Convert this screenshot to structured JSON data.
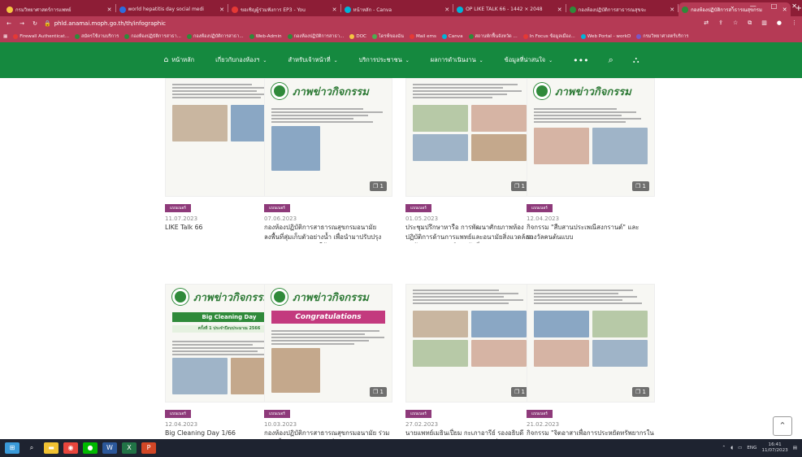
{
  "browser": {
    "tabs": [
      {
        "title": "กรมวิทยาศาสตร์การแพทย์",
        "color": "#f5c542",
        "active": false
      },
      {
        "title": "world hepatitis day social medi",
        "color": "#2d6cdf",
        "active": false
      },
      {
        "title": "ขอเชิญผู้ร่วมฟังการ EP3 - You",
        "color": "#e53935",
        "active": false
      },
      {
        "title": "หน้าหลัก - Canva",
        "color": "#00b4d8",
        "active": false
      },
      {
        "title": "OP LIKE TALK 66 - 1442 × 2048",
        "color": "#00b4d8",
        "active": false
      },
      {
        "title": "กองห้องปฏิบัติการสาธารณสุขจะ",
        "color": "#2f8a3a",
        "active": false
      },
      {
        "title": "กองห้องปฏิบัติการสาธารณสุขกรม",
        "color": "#2f8a3a",
        "active": true
      }
    ],
    "new_tab": "+",
    "window_controls": [
      "⌄",
      "—",
      "□",
      "✕"
    ],
    "url": "phld.anamai.moph.go.th/th/infographic",
    "bookmarks": [
      {
        "label": "Firewall Authenticat...",
        "color": "#e53935"
      },
      {
        "label": "สมัครใช้งานบริการ",
        "color": "#2f8a3a"
      },
      {
        "label": "กองห้องปฏิบัติการสาธา...",
        "color": "#2f8a3a"
      },
      {
        "label": "กองห้องปฏิบัติการสาธา...",
        "color": "#2f8a3a"
      },
      {
        "label": "Web-Admin",
        "color": "#2f8a3a"
      },
      {
        "label": "กองห้องปฏิบัติการสาธา...",
        "color": "#2f8a3a"
      },
      {
        "label": "DOC",
        "color": "#f5c542"
      },
      {
        "label": "ไดรฟ์ของฉัน",
        "color": "#4caf50"
      },
      {
        "label": "Mail ems",
        "color": "#e53935"
      },
      {
        "label": "Canva",
        "color": "#00b4d8"
      },
      {
        "label": "สถานพักฟื้นจังหวัด ...",
        "color": "#2f8a3a"
      },
      {
        "label": "In Focus ข้อมูลเมือง...",
        "color": "#e53935"
      },
      {
        "label": "Web Portal - workD",
        "color": "#00b4d8"
      },
      {
        "label": "กรมวิทยาศาสตร์บริการ",
        "color": "#7b57c5"
      }
    ]
  },
  "site_nav": {
    "items": [
      {
        "label": "หน้าหลัก",
        "icon": "home-icon"
      },
      {
        "label": "เกี่ยวกับกองห้องฯ",
        "caret": true
      },
      {
        "label": "สำหรับเจ้าหน้าที่",
        "caret": true
      },
      {
        "label": "บริการประชาชน",
        "caret": true
      },
      {
        "label": "ผลการดำเนินงาน",
        "caret": true
      },
      {
        "label": "ข้อมูลที่น่าสนใจ",
        "caret": true
      }
    ],
    "more": "•••",
    "search_icon": "⌕",
    "sitemap_icon": "⛬"
  },
  "cards": [
    {
      "category": "แบนเนอร์",
      "date": "11.07.2023",
      "title": "LIKE Talk 66",
      "header": "",
      "photos": 2,
      "count": "1"
    },
    {
      "category": "แบนเนอร์",
      "date": "07.06.2023",
      "title": "กองห้องปฏิบัติการสาธารณสุขกรมอนามัย ลงพื้นที่สุ่มเก็บตัวอย่างน้ำ เพื่อนำมาปรับปรุงคุณภาพสุขภาพ ของให้ประชาชน",
      "header": "ภาพข่าวกิจกรรม",
      "photos": 1,
      "count": "1"
    },
    {
      "category": "แบนเนอร์",
      "date": "01.05.2023",
      "title": "ประชุมปรึกษาหารือ การพัฒนาศักยภาพห้องปฏิบัติการด้านการแพทย์และอนามัยสิ่งแวดล้อม ณ ห้องประชุมศูนย์อนามัยที่ 10",
      "header": "",
      "photos": 4,
      "count": "1"
    },
    {
      "category": "แบนเนอร์",
      "date": "12.04.2023",
      "title": "กิจกรรม \"สืบสานประเพณีสงกรานต์\" และรางวัลคนต้นแบบ",
      "header": "ภาพข่าวกิจกรรม",
      "photos": 2,
      "count": "1"
    },
    {
      "category": "แบนเนอร์",
      "date": "12.04.2023",
      "title": "Big Cleaning Day 1/66",
      "header": "ภาพข่าวกิจกรรม",
      "band": "Big Cleaning Day",
      "band2": "ครั้งที่ 1 ประจำปีงบประมาณ 2566",
      "photos": 2,
      "count": "1"
    },
    {
      "category": "แบนเนอร์",
      "date": "10.03.2023",
      "title": "กองห้องปฏิบัติการสาธารณสุขกรมอนามัย ร่วมงานเลี้ยงเปิดศูนย์อนามัยที่ 71 ปี",
      "header": "ภาพข่าวกิจกรรม",
      "congrats": "Congratulations",
      "photos": 1,
      "count": "1"
    },
    {
      "category": "แบนเนอร์",
      "date": "27.02.2023",
      "title": "นายแพทย์เมธินเปี่ยม กะเภาอารีย์ รองอธิบดีกรมอนามัย ปฏิบัติราชการตรวจเยี่ยมหน่วยงาน",
      "header": "",
      "photos": 4,
      "count": "1"
    },
    {
      "category": "แบนเนอร์",
      "date": "21.02.2023",
      "title": "กิจกรรม \"จิตอาสาเพื่อการประหยัดทรัพยากรในองค์กรด้วยความรัก",
      "header": "",
      "photos": 4,
      "count": "1"
    }
  ],
  "scroll_top": "⌃",
  "taskbar": {
    "apps": [
      {
        "name": "start",
        "color": "#3a9ad9",
        "glyph": "⊞"
      },
      {
        "name": "search",
        "color": "#1e2330",
        "glyph": "⌕"
      },
      {
        "name": "file-explorer",
        "color": "#f1c232",
        "glyph": "▬"
      },
      {
        "name": "chrome",
        "color": "#e8453c",
        "glyph": "◉"
      },
      {
        "name": "line",
        "color": "#00b900",
        "glyph": "●"
      },
      {
        "name": "word",
        "color": "#2b579a",
        "glyph": "W"
      },
      {
        "name": "excel",
        "color": "#217346",
        "glyph": "X"
      },
      {
        "name": "powerpoint",
        "color": "#d24726",
        "glyph": "P"
      }
    ],
    "lang": "ENG",
    "time": "16:41",
    "date": "11/07/2023"
  },
  "colors": {
    "nav_green": "#15893f",
    "browser_bar": "#b53a55",
    "tag": "#8e3a7a"
  }
}
